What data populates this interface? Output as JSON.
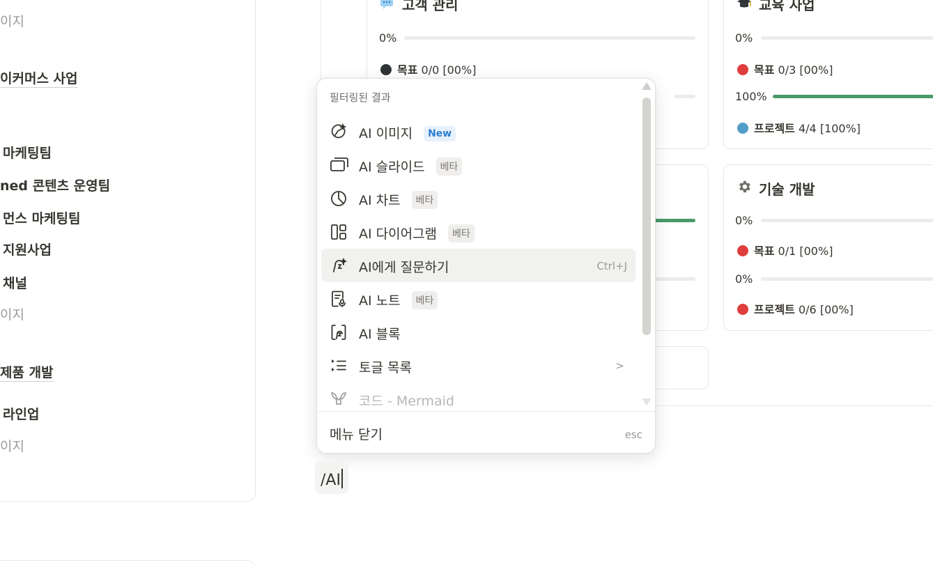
{
  "sidebar": {
    "items": [
      {
        "label": "이지",
        "style": "gray"
      },
      {
        "label": "이커머스 사업",
        "style": "bold-underline"
      },
      {
        "label": "마케팅팀",
        "style": "bold"
      },
      {
        "label": "ned 콘텐츠 운영팀",
        "style": "bold"
      },
      {
        "label": "먼스 마케팅팀",
        "style": "bold"
      },
      {
        "label": "지원사업",
        "style": "bold"
      },
      {
        "label": "채널",
        "style": "bold"
      },
      {
        "label": "이지",
        "style": "gray"
      },
      {
        "label": "제품 개발",
        "style": "bold-underline"
      },
      {
        "label": "라인업",
        "style": "bold"
      },
      {
        "label": "이지",
        "style": "gray"
      }
    ]
  },
  "cards": {
    "customer": {
      "title": "고객 관리",
      "icon": "speech-bubble-icon",
      "progress1": "0%",
      "progress1_value": 0,
      "goal_label": "목표",
      "goal_value": "0/0 [00%]",
      "goal_dot_color": "#2f3437"
    },
    "education": {
      "title": "교육 사업",
      "icon": "graduation-cap-icon",
      "progress1": "0%",
      "progress1_value": 0,
      "goal_label": "목표",
      "goal_value": "0/3 [00%]",
      "goal_dot_color": "#e03e3e",
      "progress2": "100%",
      "progress2_value": 100,
      "project_label": "프로젝트",
      "project_value": "4/4 [100%]",
      "project_dot_color": "#529cca"
    },
    "tech": {
      "title": "기술 개발",
      "icon": "gear-icon",
      "progress1": "0%",
      "progress1_value": 0,
      "goal_label": "목표",
      "goal_value": "0/1 [00%]",
      "goal_dot_color": "#e03e3e",
      "progress2": "0%",
      "progress2_value": 0,
      "project_label": "프로젝트",
      "project_value": "0/6 [00%]",
      "project_dot_color": "#e03e3e"
    }
  },
  "menu": {
    "header": "필터링된 결과",
    "items": [
      {
        "label": "AI 이미지",
        "icon": "ai-image-icon",
        "badge": "New",
        "badge_type": "new"
      },
      {
        "label": "AI 슬라이드",
        "icon": "slides-icon",
        "badge": "베타",
        "badge_type": "beta"
      },
      {
        "label": "AI 차트",
        "icon": "pie-chart-icon",
        "badge": "베타",
        "badge_type": "beta"
      },
      {
        "label": "AI 다이어그램",
        "icon": "diagram-icon",
        "badge": "베타",
        "badge_type": "beta"
      },
      {
        "label": "AI에게 질문하기",
        "icon": "ai-face-icon",
        "shortcut": "Ctrl+J",
        "active": true
      },
      {
        "label": "AI 노트",
        "icon": "ai-note-icon",
        "badge": "베타",
        "badge_type": "beta"
      },
      {
        "label": "AI 블록",
        "icon": "ai-block-icon"
      },
      {
        "label": "토글 목록",
        "icon": "toggle-list-icon",
        "chevron": ">"
      },
      {
        "label": "코드 - Mermaid",
        "icon": "mermaid-icon"
      }
    ],
    "close_label": "메뉴 닫기",
    "close_key": "esc"
  },
  "input": {
    "value": "/AI"
  }
}
